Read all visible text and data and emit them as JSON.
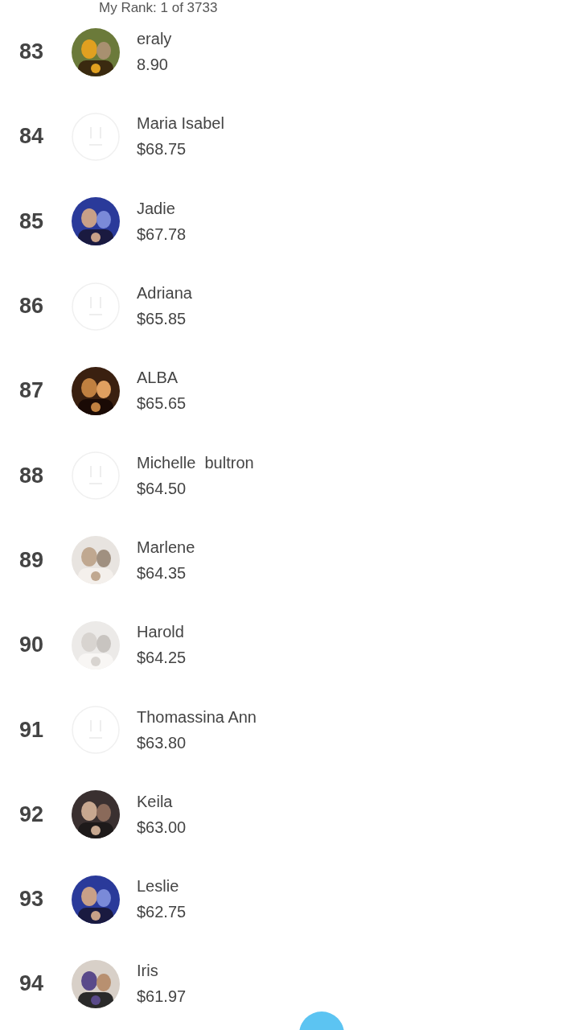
{
  "header": {
    "rank_text": "My Rank: 1 of 3733"
  },
  "rows": [
    {
      "rank": "83",
      "name": "eraly",
      "amount": "8.90"
    },
    {
      "rank": "84",
      "kind": "placeholder",
      "name": "Maria Isabel",
      "amount": "$68.75"
    },
    {
      "rank": "85",
      "name": "Jadie",
      "amount": "$67.78"
    },
    {
      "rank": "86",
      "kind": "placeholder",
      "name": "Adriana",
      "amount": "$65.85"
    },
    {
      "rank": "87",
      "name": "ALBA",
      "amount": "$65.65"
    },
    {
      "rank": "88",
      "kind": "placeholder",
      "name": "Michelle  bultron",
      "amount": "$64.50"
    },
    {
      "rank": "89",
      "name": "Marlene",
      "amount": "$64.35"
    },
    {
      "rank": "90",
      "name": "Harold",
      "amount": "$64.25"
    },
    {
      "rank": "91",
      "kind": "placeholder",
      "name": "Thomassina Ann",
      "amount": "$63.80"
    },
    {
      "rank": "92",
      "name": "Keila",
      "amount": "$63.00"
    },
    {
      "rank": "93",
      "name": "Leslie",
      "amount": "$62.75"
    },
    {
      "rank": "94",
      "name": "Iris",
      "amount": "$61.97"
    }
  ]
}
